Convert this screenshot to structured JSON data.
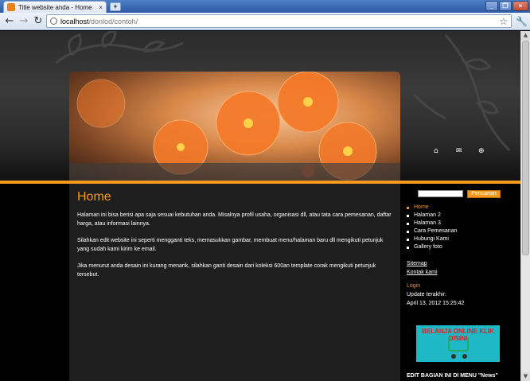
{
  "browser": {
    "tab_title": "Title website anda - Home",
    "tab_close": "×",
    "new_tab": "+",
    "win_min": "_",
    "win_max": "❐",
    "win_close": "×",
    "back": "←",
    "forward": "→",
    "reload": "↻",
    "url_host": "localhost",
    "url_path": "/donlod/contoh/",
    "star": "☆",
    "wrench": "🔧"
  },
  "header": {
    "icon_home": "⌂",
    "icon_mail": "✉",
    "icon_sitemap": "⊕"
  },
  "content": {
    "title": "Home",
    "paragraphs": [
      "Halaman ini bisa berisi apa saja sesuai kebutuhan anda. Misalnya profil usaha, organisasi dll, atau tata cara pemesanan, daftar harga, atau informasi lainnya.",
      "Silahkan edit website ini seperti mengganti teks, memasukkan gambar, membuat menu/halaman baru dll mengikuti petunjuk yang sudah kami kirim ke email.",
      "Jika menurut anda desain ini kurang menarik, silahkan ganti desain dari koleksi 600an template corak mengikuti petunjuk tersebut."
    ]
  },
  "sidebar": {
    "search_placeholder": "",
    "search_button": "Pencarian",
    "menu": [
      {
        "label": "Home",
        "active": true
      },
      {
        "label": "Halaman 2"
      },
      {
        "label": "Halaman 3"
      },
      {
        "label": "Cara Pemesanan"
      },
      {
        "label": "Hubungi Kami"
      },
      {
        "label": "Gallery foto"
      }
    ],
    "link_sitemap": "Sitemap",
    "link_kontak": "Kontak kami",
    "login_heading": "Login",
    "update_label": "Update terakhir:",
    "update_time": "April 13, 2012 15:25:42",
    "ad_text": "BELANJA ONLINE KLIK DISINI",
    "edit_note": "EDIT BAGIAN INI DI MENU \"News\" SETELAH LOGIN"
  }
}
